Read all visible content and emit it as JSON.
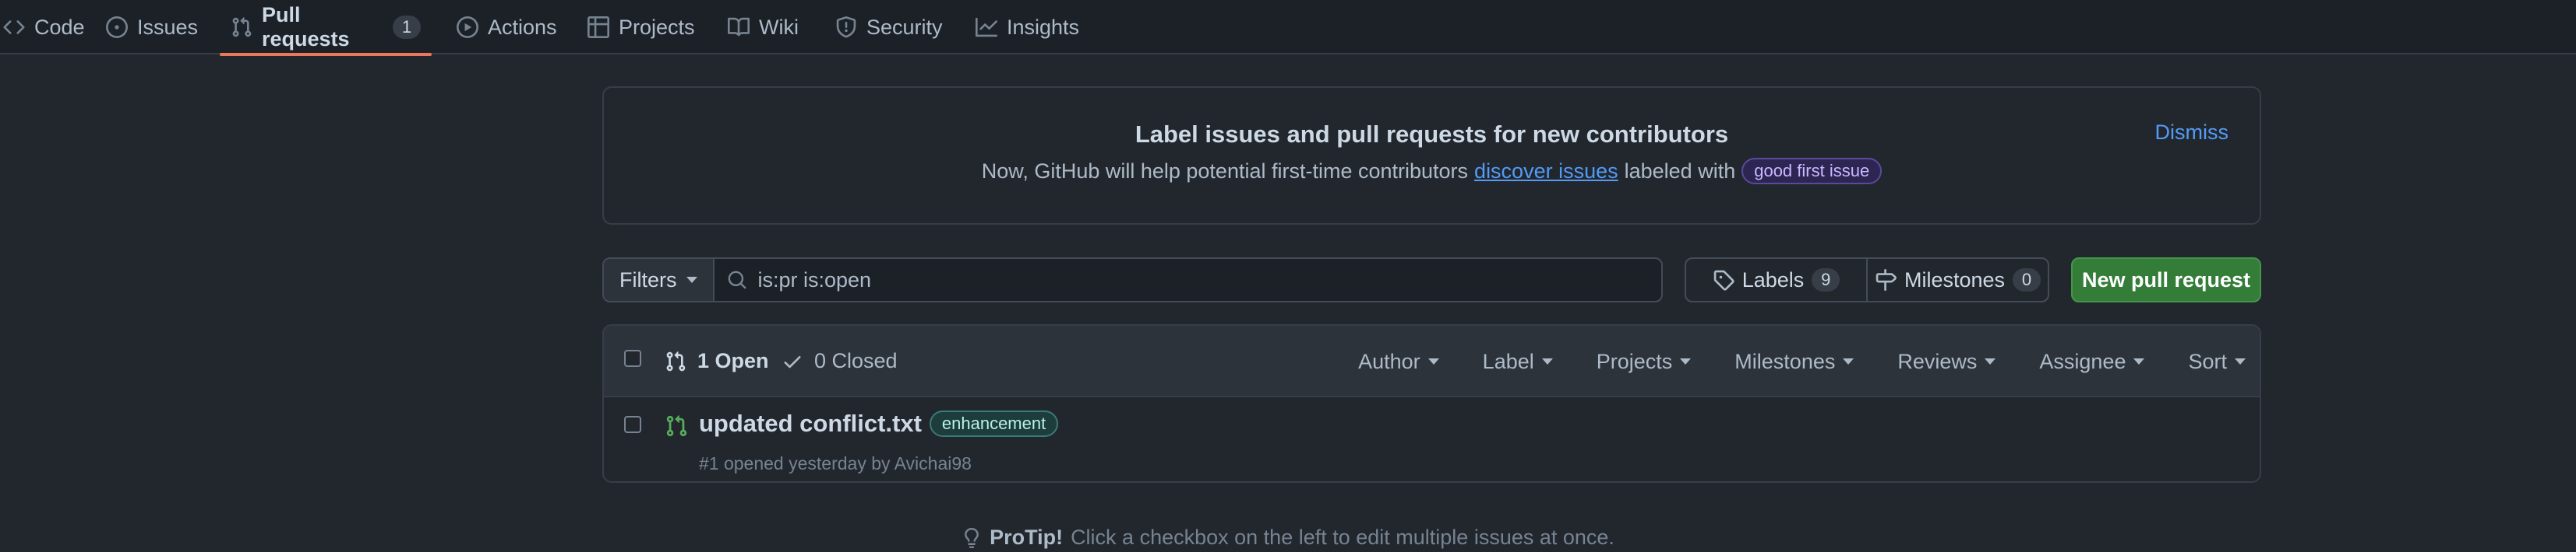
{
  "nav": {
    "tabs": [
      {
        "label": "Code",
        "icon": "code-icon"
      },
      {
        "label": "Issues",
        "icon": "issue-opened-icon"
      },
      {
        "label": "Pull requests",
        "icon": "git-pull-request-icon",
        "count": "1",
        "active": true
      },
      {
        "label": "Actions",
        "icon": "play-icon"
      },
      {
        "label": "Projects",
        "icon": "table-icon"
      },
      {
        "label": "Wiki",
        "icon": "book-icon"
      },
      {
        "label": "Security",
        "icon": "shield-icon"
      },
      {
        "label": "Insights",
        "icon": "graph-icon"
      }
    ]
  },
  "banner": {
    "title": "Label issues and pull requests for new contributors",
    "text_before": "Now, GitHub will help potential first-time contributors",
    "link": "discover issues",
    "text_after": "labeled with",
    "label": "good first issue",
    "dismiss": "Dismiss"
  },
  "filter": {
    "filters_label": "Filters",
    "query": "is:pr is:open",
    "labels_label": "Labels",
    "labels_count": "9",
    "milestones_label": "Milestones",
    "milestones_count": "0",
    "new_pr_label": "New pull request"
  },
  "list": {
    "open_label": "1 Open",
    "closed_label": "0 Closed",
    "menus": [
      "Author",
      "Label",
      "Projects",
      "Milestones",
      "Reviews",
      "Assignee",
      "Sort"
    ],
    "items": [
      {
        "title": "updated conflict.txt",
        "label": "enhancement",
        "meta": "#1 opened yesterday by Avichai98"
      }
    ]
  },
  "protip": {
    "strong": "ProTip!",
    "text": "Click a checkbox on the left to edit multiple issues at once."
  },
  "colors": {
    "background": "#22272e",
    "accent_tab": "#ec775c",
    "link": "#539bf5",
    "primary_button": "#347d39",
    "open_pr": "#57ab5a"
  }
}
